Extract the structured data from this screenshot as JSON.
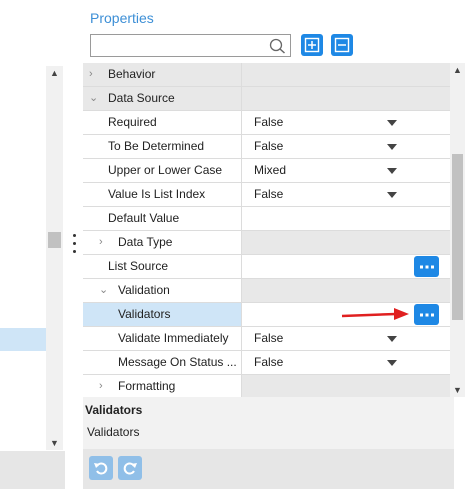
{
  "properties": {
    "title": "Properties",
    "search_placeholder": "",
    "expand_all_icon": "plus-square-icon",
    "collapse_all_icon": "minus-square-icon"
  },
  "rows": [
    {
      "label": "Behavior",
      "value": "",
      "type": "group",
      "expanded": false
    },
    {
      "label": "Data Source",
      "value": "",
      "type": "group",
      "expanded": true
    },
    {
      "label": "Required",
      "value": "False",
      "type": "dropdown"
    },
    {
      "label": "To Be Determined",
      "value": "False",
      "type": "dropdown"
    },
    {
      "label": "Upper or Lower Case",
      "value": "Mixed",
      "type": "dropdown"
    },
    {
      "label": "Value Is List Index",
      "value": "False",
      "type": "dropdown"
    },
    {
      "label": "Default Value",
      "value": "",
      "type": "text"
    },
    {
      "label": "Data Type",
      "value": "",
      "type": "subgroup",
      "expanded": false
    },
    {
      "label": "List Source",
      "value": "",
      "type": "ellipsis"
    },
    {
      "label": "Validation",
      "value": "",
      "type": "subgroup",
      "expanded": true
    },
    {
      "label": "Validators",
      "value": "",
      "type": "ellipsis",
      "selected": true
    },
    {
      "label": "Validate Immediately",
      "value": "False",
      "type": "dropdown"
    },
    {
      "label": "Message On Status ...",
      "value": "False",
      "type": "dropdown"
    },
    {
      "label": "Formatting",
      "value": "",
      "type": "subgroup",
      "expanded": false
    }
  ],
  "description": {
    "title": "Validators",
    "text": "Validators"
  },
  "colors": {
    "accent": "#1e88e5",
    "header_text": "#3d8fd6",
    "selected_row": "#cfe5f7",
    "annotation_arrow": "#e02020"
  }
}
